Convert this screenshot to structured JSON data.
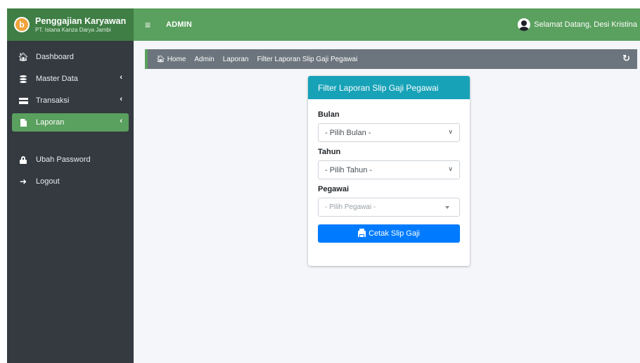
{
  "brand": {
    "logo_letter": "b",
    "title": "Penggajian Karyawan",
    "subtitle": "PT. Istana Kanza Darya Jambi"
  },
  "topbar": {
    "menu_icon": "hamburger-icon",
    "title": "ADMIN",
    "greeting": "Selamat Datang, Desi Kristina"
  },
  "sidebar": {
    "items": [
      {
        "label": "Dashboard",
        "icon": "home-icon",
        "has_arrow": false,
        "active": false
      },
      {
        "label": "Master Data",
        "icon": "database-icon",
        "has_arrow": true,
        "active": false
      },
      {
        "label": "Transaksi",
        "icon": "credit-card-icon",
        "has_arrow": true,
        "active": false
      },
      {
        "label": "Laporan",
        "icon": "file-icon",
        "has_arrow": true,
        "active": true
      },
      {
        "label": "Ubah Password",
        "icon": "lock-icon",
        "has_arrow": false,
        "active": false
      },
      {
        "label": "Logout",
        "icon": "sign-out-icon",
        "has_arrow": false,
        "active": false
      }
    ],
    "arrow_glyph": "‹"
  },
  "breadcrumb": {
    "home": "Home",
    "items": [
      "Admin",
      "Laporan",
      "Filter Laporan Slip Gaji Pegawai"
    ],
    "refresh_icon": "refresh-icon"
  },
  "card": {
    "title": "Filter Laporan Slip Gaji Pegawai",
    "fields": {
      "bulan": {
        "label": "Bulan",
        "value": "- Pilih Bulan -"
      },
      "tahun": {
        "label": "Tahun",
        "value": "- Pilih Tahun -"
      },
      "pegawai": {
        "label": "Pegawai",
        "value": "- Pilih Pegawai -"
      }
    },
    "submit_label": "Cetak Slip Gaji"
  },
  "colors": {
    "primary_green": "#5aa05e",
    "brand_green": "#3f7e45",
    "sidebar_bg": "#343a40",
    "card_header": "#17a2b8",
    "button_blue": "#007bff",
    "breadcrumb_bg": "#6c757d"
  }
}
